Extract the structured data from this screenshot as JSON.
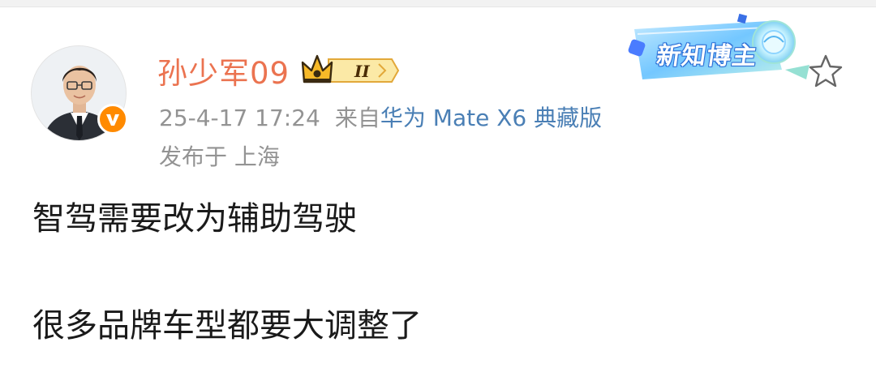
{
  "post": {
    "author": {
      "name": "孙少军09",
      "level_badge": "II",
      "verified": true
    },
    "banner": {
      "label": "新知博主"
    },
    "meta": {
      "date": "25-4-17 17:24",
      "source_prefix": "来自",
      "device": "华为 Mate X6 典藏版",
      "location": "发布于 上海"
    },
    "content": {
      "line1": "智驾需要改为辅助驾驶",
      "line2": "很多品牌车型都要大调整了"
    },
    "icons": {
      "avatar": "avatar-photo",
      "verified": "verified-v-icon",
      "crown": "crown-icon",
      "star": "star-outline-icon"
    },
    "colors": {
      "username": "#eb7350",
      "device_link": "#4a7fb5",
      "meta_gray": "#939393",
      "badge_orange": "#ff8a00",
      "banner_blue": "#3aa0ff"
    }
  }
}
